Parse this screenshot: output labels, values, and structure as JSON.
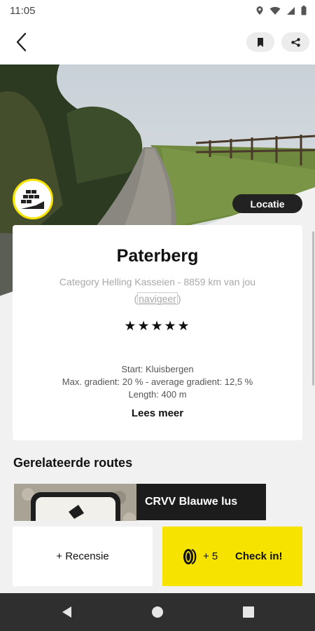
{
  "status_bar": {
    "time": "11:05"
  },
  "hero": {
    "location_label": "Locatie"
  },
  "segment": {
    "title": "Paterberg",
    "subtitle": "Category Helling Kasseien - 8859 km van jou",
    "navigate": "navigeer",
    "rating": 5,
    "rating_display": "★★★★★",
    "start": "Start: Kluisbergen",
    "gradient": "Max. gradient: 20 % - average gradient: 12,5 %",
    "length": "Length: 400 m",
    "read_more": "Lees meer"
  },
  "related": {
    "heading": "Gerelateerde routes",
    "routes": [
      {
        "name": "CRVV Blauwe lus"
      }
    ]
  },
  "actions": {
    "review": "+ Recensie",
    "points": "+ 5",
    "checkin": "Check in!"
  },
  "colors": {
    "accent": "#f6e400",
    "dark": "#1c1c1c"
  },
  "icons": {
    "back": "back-arrow-icon",
    "bookmark": "bookmark-icon",
    "share": "share-icon",
    "category": "cobblestone-climb-icon",
    "coin": "coin-icon"
  }
}
